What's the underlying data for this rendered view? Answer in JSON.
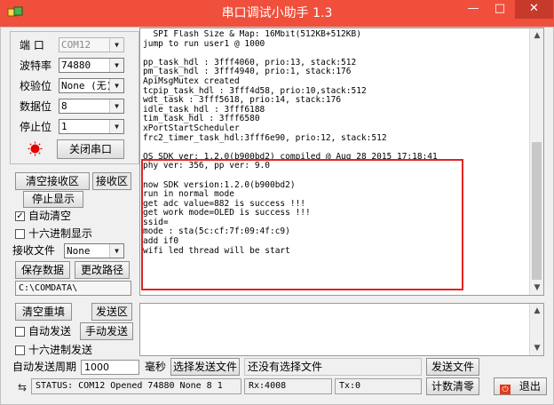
{
  "window": {
    "title": "串口调试小助手 1.3",
    "minimize_glyph": "—",
    "maximize_glyph": "□",
    "close_glyph": "✕"
  },
  "settings": {
    "port_label": "端 口",
    "port_value": "COM12",
    "baud_label": "波特率",
    "baud_value": "74880",
    "parity_label": "校验位",
    "parity_value": "None (无)",
    "databits_label": "数据位",
    "databits_value": "8",
    "stopbits_label": "停止位",
    "stopbits_value": "1",
    "close_port_label": "关闭串口"
  },
  "receive": {
    "clear_label": "清空接收区",
    "area_label": "接收区",
    "stop_display_label": "停止显示",
    "auto_clear_label": "自动清空",
    "auto_clear_checked": true,
    "hex_display_label": "十六进制显示",
    "hex_display_checked": false,
    "file_label": "接收文件",
    "file_value": "None",
    "save_label": "保存数据",
    "change_path_label": "更改路径",
    "path": "C:\\COMDATA\\"
  },
  "log_lines": [
    "  SPI Flash Size & Map: 16Mbit(512KB+512KB)",
    "jump to run user1 @ 1000",
    "",
    "pp_task_hdl : 3fff4060, prio:13, stack:512",
    "pm_task_hdl : 3fff4940, prio:1, stack:176",
    "ApiMsgMutex created",
    "tcpip_task_hdl : 3fff4d58, prio:10,stack:512",
    "wdt_task : 3fff5618, prio:14, stack:176",
    "idle_task_hdl : 3fff6188",
    "tim_task_hdl : 3fff6580",
    "xPortStartScheduler",
    "frc2_timer_task_hdl:3fff6e90, prio:12, stack:512",
    "",
    "OS SDK ver: 1.2.0(b900bd2) compiled @ Aug 28 2015 17:18:41",
    "phy ver: 356, pp ver: 9.0",
    "",
    "now SDK version:1.2.0(b900bd2)",
    "run in normal mode",
    "get adc value=882 is success !!!",
    "get work mode=OLED is success !!!",
    "ssid=",
    "mode : sta(5c:cf:7f:09:4f:c9)",
    "add if0",
    "wifi led thread will be start"
  ],
  "send": {
    "clear_label": "清空重填",
    "area_label": "发送区",
    "auto_send_label": "自动发送",
    "auto_send_checked": false,
    "manual_send_label": "手动发送",
    "hex_send_label": "十六进制发送",
    "hex_send_checked": false,
    "period_label": "自动发送周期",
    "period_value": "1000",
    "ms_label": "毫秒",
    "choose_file_label": "选择发送文件",
    "no_file_text": "还没有选择文件",
    "send_file_label": "发送文件"
  },
  "status": {
    "text": "STATUS: COM12 Opened 74880 None  8 1",
    "rx": "Rx:4008",
    "tx": "Tx:0",
    "reset_count_label": "计数清零",
    "exit_label": "退出"
  },
  "colors": {
    "titlebar": "#f04f3c",
    "highlight_box": "#e32222",
    "port_indicator": "#e00000"
  }
}
